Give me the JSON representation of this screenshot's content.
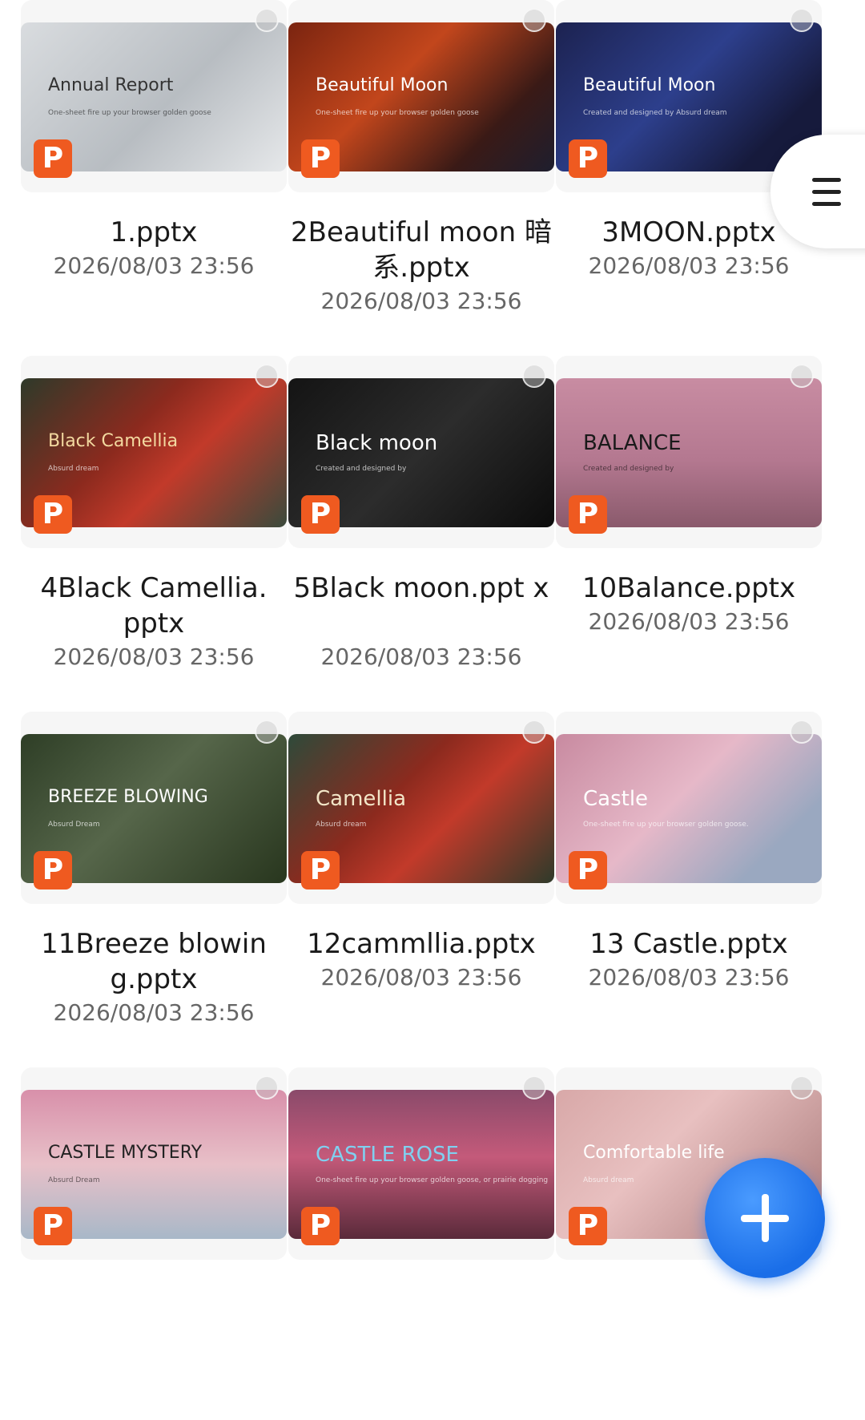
{
  "files": [
    {
      "name": "1.pptx",
      "date": "2026/08/03 23:56",
      "thumb_title": "Annual Report",
      "thumb_sub": "One-sheet fire up your browser golden goose",
      "badge": "P",
      "bg": "linear-gradient(135deg,#d9dcdf,#b8bdc2 55%,#e6e8ea)",
      "fg": "#333333"
    },
    {
      "name": "2Beautiful moon 暗系.pptx",
      "date": "2026/08/03 23:56",
      "thumb_title": "Beautiful Moon",
      "thumb_sub": "One-sheet fire up your browser golden goose",
      "badge": "P",
      "bg": "linear-gradient(135deg,#7a2410,#c2461c 40%,#3a1a16 75%,#1e1e2e)",
      "fg": "#ffffff"
    },
    {
      "name": "3MOON.pptx",
      "date": "2026/08/03 23:56",
      "thumb_title": "Beautiful Moon",
      "thumb_sub": "Created and designed by Absurd dream",
      "badge": "P",
      "bg": "linear-gradient(135deg,#1c2250,#2d3f8c 45%,#161a3c 80%)",
      "fg": "#ffffff"
    },
    {
      "name": "4Black Camellia. pptx",
      "date": "2026/08/03 23:56",
      "thumb_title": "Black Camellia",
      "thumb_sub": "Absurd dream",
      "badge": "P",
      "bg": "linear-gradient(135deg,#2e3a2a,#8c2a1e 40%,#c23a2a 60%,#3a4a3c)",
      "fg": "#f3d9a0"
    },
    {
      "name": "5Black moon.ppt x",
      "date": "2026/08/03 23:56",
      "thumb_title": "Black moon",
      "thumb_sub": "Created and designed by",
      "badge": "P",
      "bg": "linear-gradient(135deg,#141414,#2c2c2c 50%,#0c0c0c)",
      "fg": "#ffffff"
    },
    {
      "name": "10Balance.pptx",
      "date": "2026/08/03 23:56",
      "thumb_title": "BALANCE",
      "thumb_sub": "Created and designed by",
      "badge": "P",
      "bg": "linear-gradient(180deg,#c88ca2,#b47890 55%,#8a5a6c)",
      "fg": "#1a1a1a"
    },
    {
      "name": "11Breeze blowin g.pptx",
      "date": "2026/08/03 23:56",
      "thumb_title": "BREEZE BLOWING",
      "thumb_sub": "Absurd Dream",
      "badge": "P",
      "bg": "linear-gradient(135deg,#2e3e26,#56664a 45%,#28361e)",
      "fg": "#ffffff"
    },
    {
      "name": "12cammllia.pptx",
      "date": "2026/08/03 23:56",
      "thumb_title": "Camellia",
      "thumb_sub": "Absurd dream",
      "badge": "P",
      "bg": "linear-gradient(135deg,#2e4a3a,#8c2a1e 40%,#c23a2a 60%,#2e3a2a)",
      "fg": "#f3e6c8"
    },
    {
      "name": "13 Castle.pptx",
      "date": "2026/08/03 23:56",
      "thumb_title": "Castle",
      "thumb_sub": "One-sheet fire up your browser golden goose.",
      "badge": "P",
      "bg": "linear-gradient(135deg,#c88aa0,#e6b8c8 45%,#9aa8c0 80%)",
      "fg": "#ffffff"
    },
    {
      "name": "",
      "date": "",
      "thumb_title": "CASTLE MYSTERY",
      "thumb_sub": "Absurd Dream",
      "badge": "P",
      "bg": "linear-gradient(180deg,#d890aa,#e8c0c8 50%,#a8b8c8)",
      "fg": "#222222"
    },
    {
      "name": "",
      "date": "",
      "thumb_title": "CASTLE ROSE",
      "thumb_sub": "One-sheet fire up your browser golden goose, or prairie dogging",
      "badge": "P",
      "bg": "linear-gradient(180deg,#8a4a6a,#c45a7a 45%,#5a2a3a)",
      "fg": "#7fd0f0"
    },
    {
      "name": "",
      "date": "",
      "thumb_title": "Comfortable life",
      "thumb_sub": "Absurd dream",
      "badge": "P",
      "bg": "linear-gradient(135deg,#d8a8a8,#e8c0c0 40%,#a87878)",
      "fg": "#ffffff"
    }
  ],
  "menu": {
    "icon": "hamburger-menu-icon"
  },
  "fab": {
    "icon": "plus-icon"
  }
}
